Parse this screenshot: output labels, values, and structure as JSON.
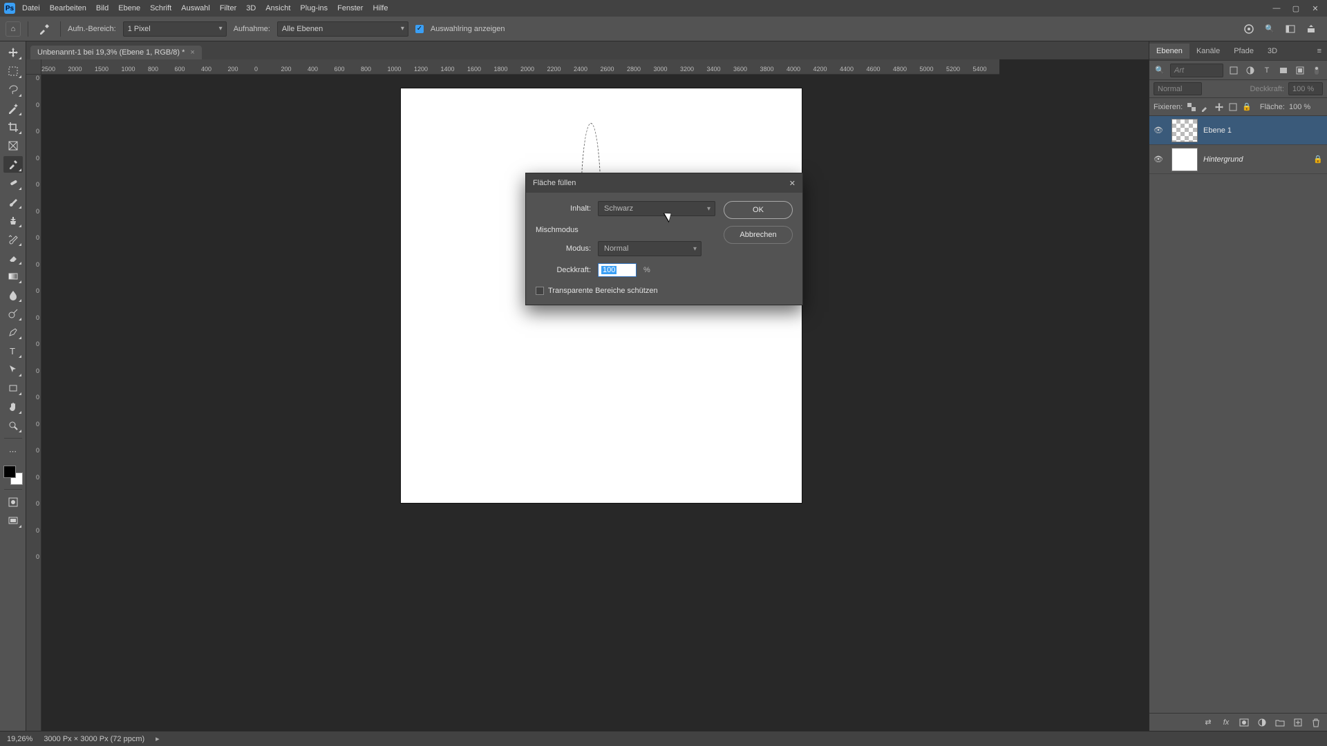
{
  "app": {
    "logo": "Ps"
  },
  "menu": {
    "items": [
      "Datei",
      "Bearbeiten",
      "Bild",
      "Ebene",
      "Schrift",
      "Auswahl",
      "Filter",
      "3D",
      "Ansicht",
      "Plug-ins",
      "Fenster",
      "Hilfe"
    ]
  },
  "options_bar": {
    "aufn_label": "Aufn.-Bereich:",
    "aufn_value": "1 Pixel",
    "aufn_target_label": "Aufnahme:",
    "aufn_target_value": "Alle Ebenen",
    "show_ring_label": "Auswahlring anzeigen"
  },
  "document": {
    "tab_title": "Unbenannt-1 bei 19,3% (Ebene 1, RGB/8) *"
  },
  "ruler": {
    "h": [
      "2500",
      "2000",
      "1500",
      "1000",
      "800",
      "600",
      "400",
      "200",
      "0",
      "200",
      "400",
      "600",
      "800",
      "1000",
      "1200",
      "1400",
      "1600",
      "1800",
      "2000",
      "2200",
      "2400",
      "2600",
      "2800",
      "3000",
      "3200",
      "3400",
      "3600",
      "3800",
      "4000",
      "4200",
      "4400",
      "4600",
      "4800",
      "5000",
      "5200",
      "5400"
    ],
    "v": [
      "0",
      "0",
      "0",
      "0",
      "0",
      "0",
      "0",
      "0",
      "0",
      "0",
      "0",
      "0",
      "0",
      "0",
      "0",
      "0",
      "0",
      "0",
      "0"
    ]
  },
  "dialog": {
    "title": "Fläche füllen",
    "content_label": "Inhalt:",
    "content_value": "Schwarz",
    "blend_section": "Mischmodus",
    "mode_label": "Modus:",
    "mode_value": "Normal",
    "opacity_label": "Deckkraft:",
    "opacity_value": "100",
    "opacity_unit": "%",
    "preserve_transparency": "Transparente Bereiche schützen",
    "ok": "OK",
    "cancel": "Abbrechen"
  },
  "panels": {
    "tabs": [
      "Ebenen",
      "Kanäle",
      "Pfade",
      "3D"
    ],
    "filter_placeholder": "Art",
    "blend_mode": "Normal",
    "opacity_label": "Deckkraft:",
    "opacity_value": "100 %",
    "lock_label": "Fixieren:",
    "fill_label": "Fläche:",
    "fill_value": "100 %",
    "layers": [
      {
        "name": "Ebene 1",
        "checker": true,
        "selected": true,
        "italic": false,
        "locked": false
      },
      {
        "name": "Hintergrund",
        "checker": false,
        "selected": false,
        "italic": true,
        "locked": true
      }
    ]
  },
  "status": {
    "zoom": "19,26%",
    "doc_info": "3000 Px × 3000 Px (72 ppcm)"
  },
  "tools": [
    "move",
    "marquee",
    "lasso",
    "magic-wand",
    "crop",
    "frame",
    "eyedropper",
    "spot-heal",
    "brush",
    "clone",
    "history-brush",
    "eraser",
    "gradient",
    "blur",
    "dodge",
    "pen",
    "type",
    "path-select",
    "rectangle",
    "hand",
    "zoom"
  ],
  "tool_extras": [
    "edit-toolbar",
    "quick-mask",
    "screen-mode"
  ]
}
